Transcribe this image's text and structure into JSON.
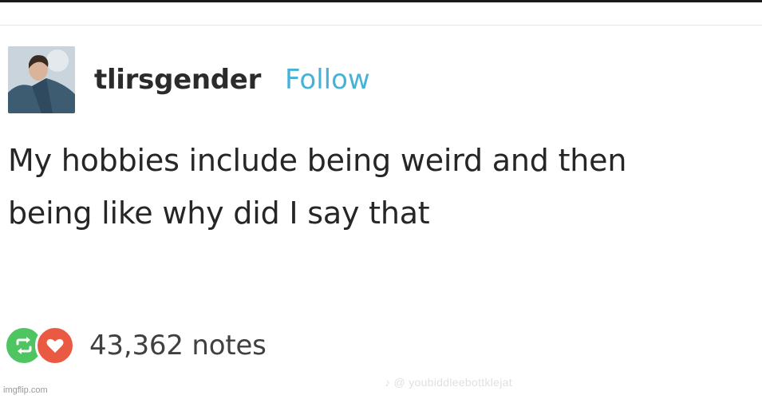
{
  "post": {
    "username": "tlirsgender",
    "follow_label": "Follow",
    "text_lines": [
      "My hobbies include being weird and then",
      "being like why did I say that"
    ],
    "notes_label": "43,362 notes"
  },
  "icons": {
    "reblog": "reblog-icon",
    "like": "heart-icon",
    "avatar": "avatar"
  },
  "colors": {
    "follow": "#46b2d6",
    "reblog": "#4fc562",
    "like": "#ea5a43",
    "text": "#262626"
  },
  "watermarks": {
    "imgflip": "imgflip.com",
    "tiktok": "♪ @ youbiddleebottklejat"
  }
}
